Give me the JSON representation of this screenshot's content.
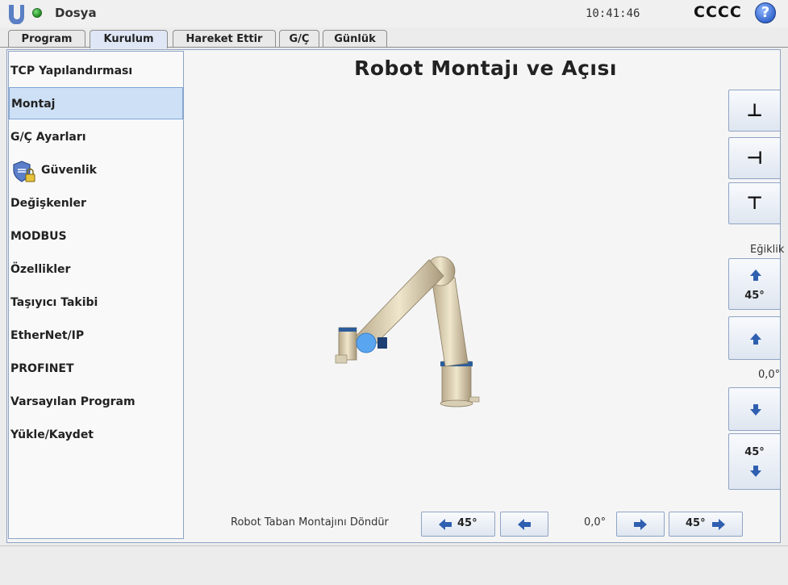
{
  "header": {
    "file_label": "Dosya",
    "clock": "10:41:46",
    "robot_name": "CCCC",
    "help_glyph": "?",
    "status_color": "#2fa82f"
  },
  "tabs": [
    {
      "label": "Program"
    },
    {
      "label": "Kurulum"
    },
    {
      "label": "Hareket Ettir"
    },
    {
      "label": "G/Ç"
    },
    {
      "label": "Günlük"
    }
  ],
  "sidebar": {
    "items": [
      {
        "label": "TCP Yapılandırması"
      },
      {
        "label": "Montaj"
      },
      {
        "label": "G/Ç Ayarları"
      },
      {
        "label": "Güvenlik",
        "icon": "shield-lock-icon"
      },
      {
        "label": "Değişkenler"
      },
      {
        "label": "MODBUS"
      },
      {
        "label": "Özellikler"
      },
      {
        "label": "Taşıyıcı Takibi"
      },
      {
        "label": "EtherNet/IP"
      },
      {
        "label": "PROFINET"
      },
      {
        "label": "Varsayılan Program"
      },
      {
        "label": "Yükle/Kaydet"
      }
    ],
    "active_index": 1
  },
  "main": {
    "title": "Robot Montajı ve Açısı",
    "tilt": {
      "label": "Eğiklik",
      "up45_text": "45°",
      "down45_text": "45°",
      "value": "0,0°"
    },
    "rotation": {
      "label": "Robot Taban Montajını Döndür",
      "left45_text": "45°",
      "right45_text": "45°",
      "value": "0,0°"
    },
    "view_buttons": [
      {
        "icon": "floor-mount-icon",
        "glyph": "⊥"
      },
      {
        "icon": "wall-mount-icon",
        "glyph": "⊣"
      },
      {
        "icon": "ceiling-mount-icon",
        "glyph": "⊤"
      }
    ]
  },
  "colors": {
    "accent": "#4a90e2",
    "panel_border": "#8fa4c4",
    "active_row": "#cde0f5"
  }
}
